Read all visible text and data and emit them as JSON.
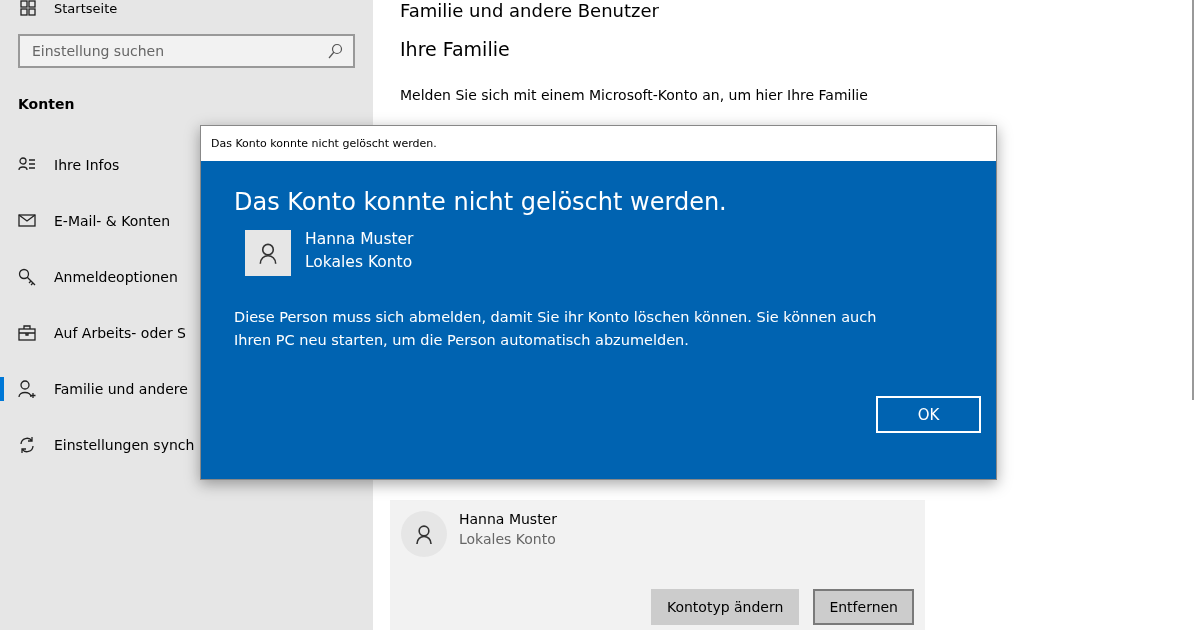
{
  "sidebar": {
    "home": {
      "label": "Startseite"
    },
    "search": {
      "placeholder": "Einstellung suchen"
    },
    "section": "Konten",
    "items": [
      {
        "label": "Ihre Infos",
        "selected": false
      },
      {
        "label": "E-Mail- & Konten",
        "selected": false
      },
      {
        "label": "Anmeldeoptionen",
        "selected": false
      },
      {
        "label": "Auf Arbeits- oder S",
        "selected": false
      },
      {
        "label": "Familie und andere",
        "selected": true
      },
      {
        "label": "Einstellungen synch",
        "selected": false
      }
    ]
  },
  "main": {
    "title": "Familie und andere Benutzer",
    "section": "Ihre Familie",
    "description": "Melden Sie sich mit einem Microsoft-Konto an, um hier Ihre Familie",
    "user_card": {
      "name": "Hanna Muster",
      "account": "Lokales Konto",
      "buttons": [
        {
          "label": "Kontotyp ändern",
          "kind": "filled"
        },
        {
          "label": "Entfernen",
          "kind": "outlined"
        }
      ]
    }
  },
  "dialog": {
    "window_title": "Das Konto konnte nicht gelöscht werden.",
    "heading": "Das Konto konnte nicht gelöscht werden.",
    "user": {
      "name": "Hanna Muster",
      "account": "Lokales Konto"
    },
    "message": "Diese Person muss sich abmelden, damit Sie ihr Konto löschen können. Sie können auch Ihren PC neu starten, um die Person automatisch abzumelden.",
    "button": "OK"
  }
}
